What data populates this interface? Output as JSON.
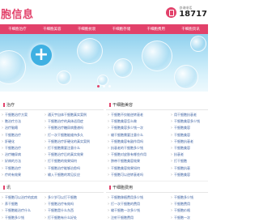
{
  "header": {
    "logo_text": "胞信息",
    "phone_caption": "咨询电话",
    "phone_number": "18717"
  },
  "nav": [
    "干细胞治疗",
    "干细胞美容",
    "干细胞抗衰",
    "干细胞存储",
    "干细胞费用",
    "干细胞资讯"
  ],
  "banner": {
    "slide_count": 3,
    "active_index": 0
  },
  "sections": {
    "therapy": {
      "title": "治疗",
      "col1": [
        "干细胞治疗方案",
        "胞治疗方法",
        "治疗脑瘫",
        "干细胞治疗",
        "肝硬化",
        "干细胞治疗",
        "治疗糖尿病",
        "好病的方法",
        "干细胞治疗",
        "疗的有效果"
      ],
      "col2": [
        "通天宇自体干细胞真实案例",
        "干细胞治疗的具体适用症",
        "干细胞治疗糖尿病靠谱吗",
        "打一次干细胞能维持多久",
        "干细胞治疗肝硬化的真实案例",
        "打干细胞需要注意什么",
        "干细胞治疗后的真实效果",
        "打干细胞的效果如何",
        "干细胞治疗能够治愈吗",
        "输入干细胞的常见反应"
      ]
    },
    "beauty": {
      "title": "干细胞美容",
      "col1": [
        "干细胞不仅能逆转衰老",
        "干细胞美容怎么做",
        "干细胞美容多少钱一次",
        "输干细胞需要注意什么",
        "干细胞美容有副作用吗",
        "抗衰老的干细胞多少钱",
        "干细胞对皮肤有哪些作用",
        "脐带干细胞美容效果",
        "干细胞美容效果如何",
        "干细胞可以逆转衰老吗"
      ],
      "col2": [
        "用干细胞抗衰老",
        "干细胞美容多少钱",
        "干细胞美容",
        "干细胞美容",
        "干细胞抗衰老",
        "干细胞美容",
        "抗衰老",
        "打干细胞",
        "干细胞抗衰",
        "干细胞美容"
      ]
    },
    "news": {
      "title": "讯",
      "col1": [
        "干细胞可以治疗的疾病",
        "养干细胞",
        "干细胞能治疗什么",
        "干细胞多少钱"
      ],
      "col2": [
        "多少岁可以打干细胞",
        "干细胞治疗有效吗",
        "干细胞是什么东西",
        "打干细胞有什么好处"
      ]
    },
    "cost": {
      "title": "干细胞费用",
      "col1": [
        "干细胞移植费用多少钱",
        "打一次干细胞的费用",
        "输干细胞一次多少钱",
        "注射干细胞费用"
      ],
      "col2": [
        "干细胞多少钱",
        "干细胞费用",
        "干细胞价格",
        "干细胞一次"
      ]
    }
  }
}
